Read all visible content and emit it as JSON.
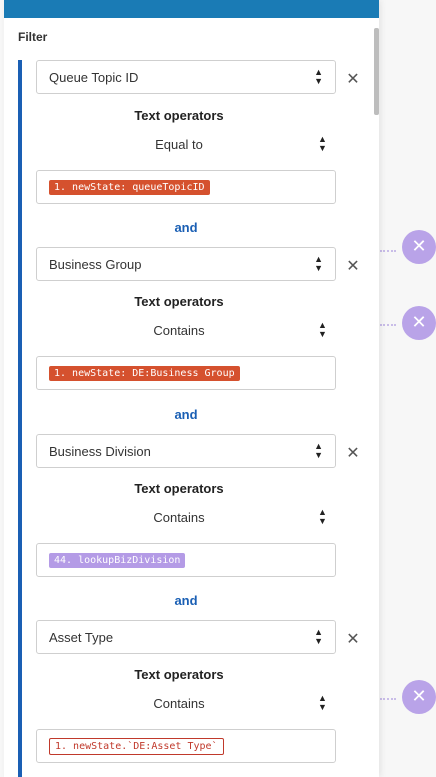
{
  "panel": {
    "title": "Filter"
  },
  "conditions": [
    {
      "field": "Queue Topic ID",
      "operator_label": "Text operators",
      "operator": "Equal to",
      "value_token": "1. newState: queueTopicID"
    },
    {
      "field": "Business Group",
      "operator_label": "Text operators",
      "operator": "Contains",
      "value_token": "1. newState: DE:Business Group"
    },
    {
      "field": "Business Division",
      "operator_label": "Text operators",
      "operator": "Contains",
      "value_token": "44. lookupBizDivision"
    },
    {
      "field": "Asset Type",
      "operator_label": "Text operators",
      "operator": "Contains",
      "value_token": "1. newState.`DE:Asset Type`"
    }
  ],
  "connectors": [
    "and",
    "and",
    "and"
  ],
  "icons": {
    "remove": "close-icon",
    "sort": "sort-icon",
    "background_node": "tools-icon"
  },
  "colors": {
    "header": "#1a7bb5",
    "accent_bar": "#1a5fb4",
    "pill_red": "#d5512e",
    "pill_purple": "#b49be6",
    "and_text": "#1a5fb4"
  }
}
